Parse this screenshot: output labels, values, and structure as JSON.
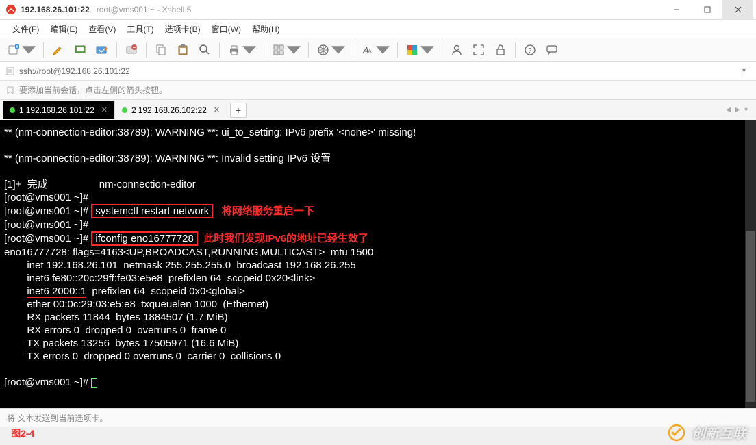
{
  "title": {
    "main": "192.168.26.101:22",
    "sub": "root@vms001:~ - Xshell 5"
  },
  "menus": [
    "文件(F)",
    "编辑(E)",
    "查看(V)",
    "工具(T)",
    "选项卡(B)",
    "窗口(W)",
    "帮助(H)"
  ],
  "address": "ssh://root@192.168.26.101:22",
  "tip": "要添加当前会话，点击左侧的箭头按钮。",
  "tabs": [
    {
      "num": "1",
      "label": "192.168.26.101:22",
      "active": true
    },
    {
      "num": "2",
      "label": "192.168.26.102:22",
      "active": false
    }
  ],
  "term": {
    "l1": "** (nm-connection-editor:38789): WARNING **: ui_to_setting: IPv6 prefix '<none>' missing!",
    "l2": "** (nm-connection-editor:38789): WARNING **: Invalid setting IPv6 设置",
    "l3": "[1]+  完成                  nm-connection-editor",
    "l4": "[root@vms001 ~]#",
    "l5p": "[root@vms001 ~]# ",
    "l5b": "systemctl restart network",
    "l5a": "将网络服务重启一下",
    "l6": "[root@vms001 ~]#",
    "l7p": "[root@vms001 ~]# ",
    "l7b": "ifconfig eno16777728",
    "l7a": "此时我们发现IPv6的地址已经生效了",
    "l8": "eno16777728: flags=4163<UP,BROADCAST,RUNNING,MULTICAST>  mtu 1500",
    "l9": "        inet 192.168.26.101  netmask 255.255.255.0  broadcast 192.168.26.255",
    "l10": "        inet6 fe80::20c:29ff:fe03:e5e8  prefixlen 64  scopeid 0x20<link>",
    "l11a": "        ",
    "l11b": "inet6 2000::1",
    "l11c": "  prefixlen 64  scopeid 0x0<global>",
    "l12": "        ether 00:0c:29:03:e5:e8  txqueuelen 1000  (Ethernet)",
    "l13": "        RX packets 11844  bytes 1884507 (1.7 MiB)",
    "l14": "        RX errors 0  dropped 0  overruns 0  frame 0",
    "l15": "        TX packets 13256  bytes 17505971 (16.6 MiB)",
    "l16": "        TX errors 0  dropped 0 overruns 0  carrier 0  collisions 0",
    "l17": "[root@vms001 ~]# "
  },
  "status": "将   文本发送到当前选项卡。",
  "figure": "图2-4",
  "watermark": "创新互联"
}
